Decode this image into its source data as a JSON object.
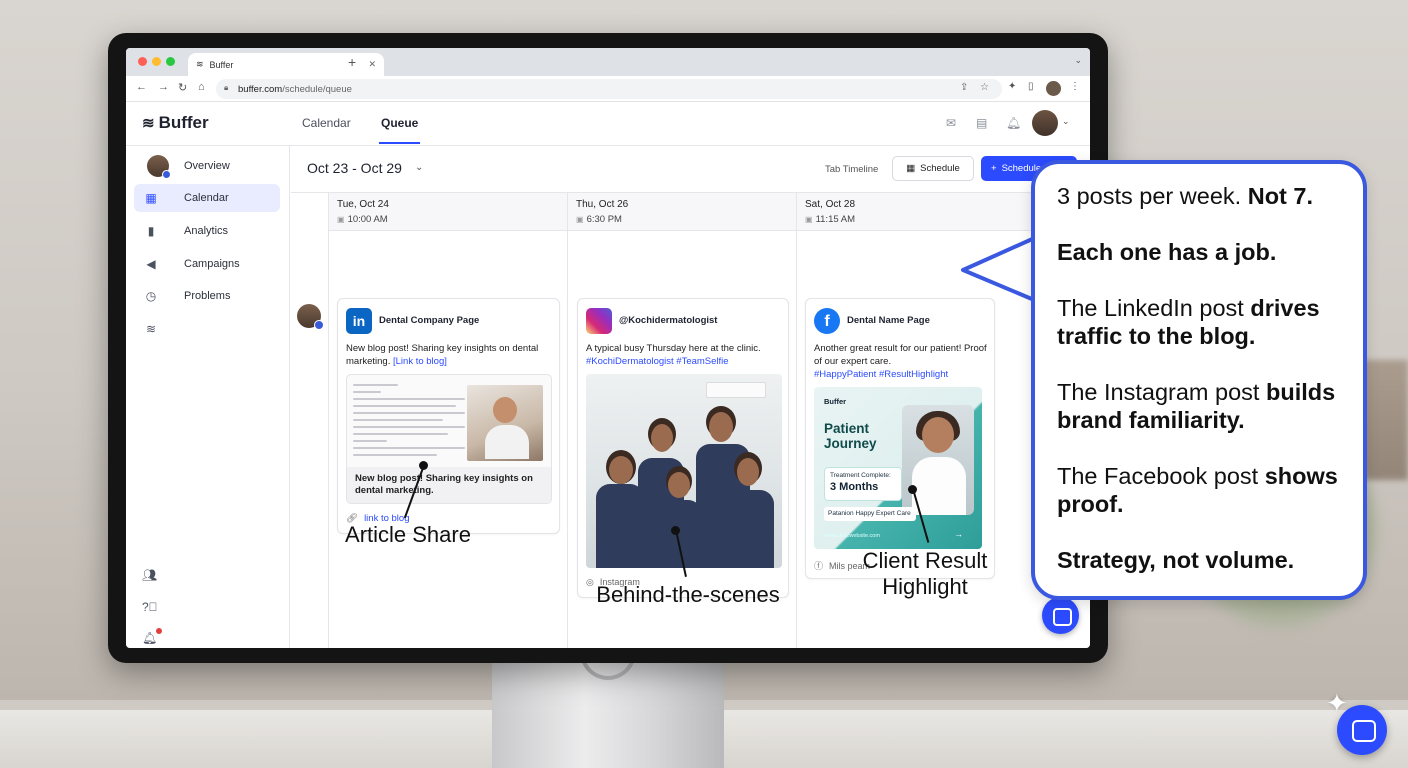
{
  "browser": {
    "tab_title": "Buffer",
    "url_host": "buffer.com",
    "url_path": "/schedule/queue"
  },
  "app": {
    "logo": "Buffer",
    "nav_tabs": [
      {
        "label": "Calendar",
        "active": false
      },
      {
        "label": "Queue",
        "active": true
      }
    ]
  },
  "sidebar": {
    "items": [
      {
        "label": "Overview"
      },
      {
        "label": "Calendar",
        "active": true
      },
      {
        "label": "Analytics"
      },
      {
        "label": "Campaigns"
      },
      {
        "label": "Problems"
      }
    ]
  },
  "main": {
    "date_range": "Oct 23 - Oct 29",
    "timeline_link": "Tab Timeline",
    "schedule_button": "Schedule",
    "schedule_primary": "Schedule",
    "columns": [
      {
        "day": "Tue, Oct 24",
        "time": "10:00 AM"
      },
      {
        "day": "Thu, Oct 26",
        "time": "6:30 PM"
      },
      {
        "day": "Sat, Oct 28",
        "time": "11:15 AM"
      }
    ]
  },
  "posts": {
    "linkedin": {
      "channel": "Dental Company Page",
      "text": "New blog post! Sharing key insights on dental marketing.",
      "link_text": "[Link to blog]",
      "preview_title": "New blog post! Sharing key insights on dental marketing.",
      "link_label": "link to blog"
    },
    "instagram": {
      "channel": "@Kochidermatologist",
      "text": "A typical busy Thursday here at the clinic.",
      "hashtags": "#KochiDermatologist #TeamSelfie",
      "footer": "Instagram"
    },
    "facebook": {
      "channel": "Dental Name Page",
      "text": "Another great result for our patient! Proof of our expert care.",
      "hashtags": "#HappyPatient #ResultHighlight",
      "footer": "Mils peam",
      "promo": {
        "brand": "Buffer",
        "title_1": "Patient",
        "title_2": "Journey",
        "box_label": "Treatment Complete:",
        "box_value": "3 Months",
        "pill": "Patanion Happy Expert Care",
        "url": "www.clinicwebsite.com"
      }
    }
  },
  "annotations": {
    "article": "Article Share",
    "bts": "Behind-the-scenes",
    "client_1": "Client Result",
    "client_2": "Highlight"
  },
  "callout": {
    "l1_normal": "3 posts per week. ",
    "l1_bold": "Not 7.",
    "l2_bold": "Each one has a job.",
    "l3_normal": "The LinkedIn post ",
    "l3_bold": "drives traffic to the blog.",
    "l4_normal": "The Instagram post ",
    "l4_bold": "builds brand familiarity.",
    "l5_normal": "The Facebook post ",
    "l5_bold": "shows proof.",
    "l6_bold": "Strategy, not volume."
  },
  "colors": {
    "accent": "#2c4bff",
    "callout_border": "#3a59e0"
  }
}
